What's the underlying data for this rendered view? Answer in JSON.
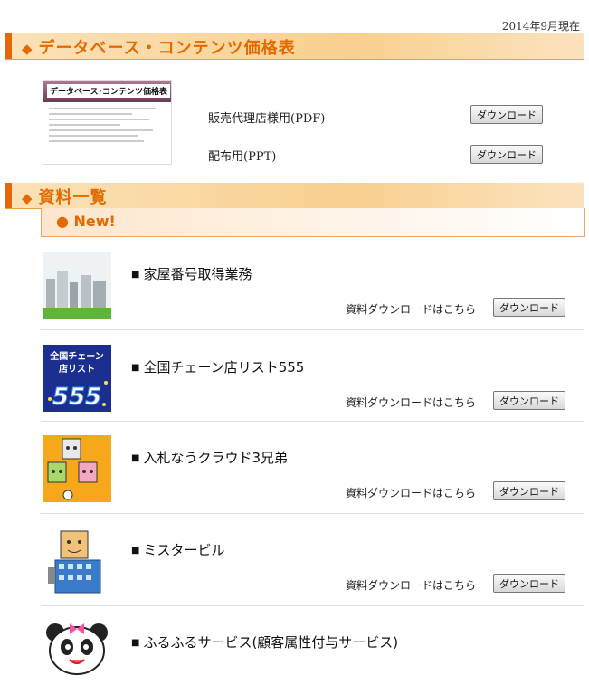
{
  "date_label": "2014年9月現在",
  "section_price": {
    "title": "データベース・コンテンツ価格表",
    "thumb_text": "データベース･コンテンツ価格表",
    "rows": [
      {
        "label": "販売代理店様用(PDF)",
        "button": "ダウンロード"
      },
      {
        "label": "配布用(PPT)",
        "button": "ダウンロード"
      }
    ]
  },
  "section_docs": {
    "title": "資料一覧",
    "new_label": "● New!",
    "download_text": "資料ダウンロードはこちら",
    "button_label": "ダウンロード",
    "items": [
      {
        "name": "家屋番号取得業務",
        "icon": "buildings-photo"
      },
      {
        "name": "全国チェーン店リスト555",
        "icon": "chain-list-555-badge",
        "badge_top": "全国チェーン",
        "badge_mid": "店リスト",
        "badge_num": "555"
      },
      {
        "name": "入札なうクラウド3兄弟",
        "icon": "cloud-brothers-characters"
      },
      {
        "name": "ミスタービル",
        "icon": "mister-building-character"
      },
      {
        "name": "ふるふるサービス(顧客属性付与サービス)",
        "icon": "panda-character"
      }
    ]
  },
  "colors": {
    "accent": "#e36a00",
    "bar": "#e8660a"
  }
}
